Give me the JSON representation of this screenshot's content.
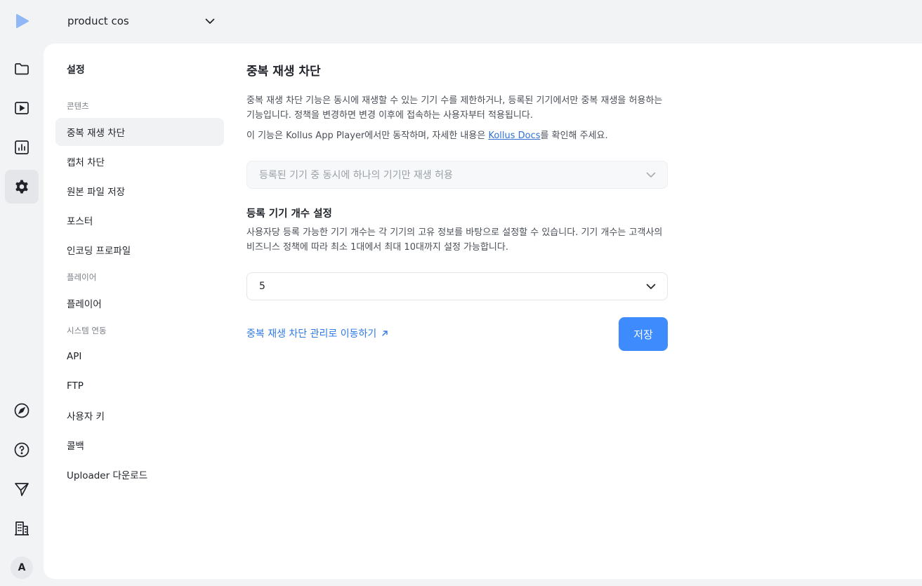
{
  "project": {
    "name": "product cos"
  },
  "rail": {
    "avatar_letter": "A",
    "icons": [
      "play-logo-icon",
      "folder-icon",
      "video-icon",
      "chart-icon",
      "gear-icon",
      "compass-icon",
      "help-icon",
      "send-icon",
      "building-icon"
    ],
    "accent": "#8fb8f5"
  },
  "subnav": {
    "title": "설정",
    "sections": [
      {
        "label": "콘텐츠",
        "items": [
          "중복 재생 차단",
          "캡처 차단",
          "원본 파일 저장",
          "포스터",
          "인코딩 프로파일"
        ]
      },
      {
        "label": "플레이어",
        "items": [
          "플레이어"
        ]
      },
      {
        "label": "시스템 연동",
        "items": [
          "API",
          "FTP",
          "사용자 키",
          "콜백",
          "Uploader 다운로드"
        ]
      }
    ],
    "active_item": "중복 재생 차단"
  },
  "content": {
    "title": "중복 재생 차단",
    "desc_line1": "중복 재생 차단 기능은 동시에 재생할 수 있는 기기 수를 제한하거나, 등록된 기기에서만 중복 재생을 허용하는",
    "desc_line2": "기능입니다. 정책을 변경하면 변경 이후에 접속하는 사용자부터 적용됩니다.",
    "note_prefix": "이 기능은 Kollus App Player에서만 동작하며, 자세한 내용은 ",
    "note_link": "Kollus Docs",
    "note_suffix": "를 확인해 주세요.",
    "policy_select": "등록된 기기 중 동시에 하나의 기기만 재생 허용",
    "device_title": "등록 기기 개수 설정",
    "device_desc_line1": "사용자당 등록 가능한 기기 개수는 각 기기의 고유 정보를 바탕으로 설정할 수 있습니다. 기기 개수는 고객사의",
    "device_desc_line2": "비즈니스 정책에 따라 최소 1대에서 최대 10대까지 설정 가능합니다.",
    "device_count": "5",
    "manage_link": "중복 재생 차단 관리로 이동하기",
    "save_label": "저장"
  },
  "colors": {
    "primary": "#3d8bfd",
    "link": "#2f7ae5",
    "background": "#f2f3f5"
  }
}
